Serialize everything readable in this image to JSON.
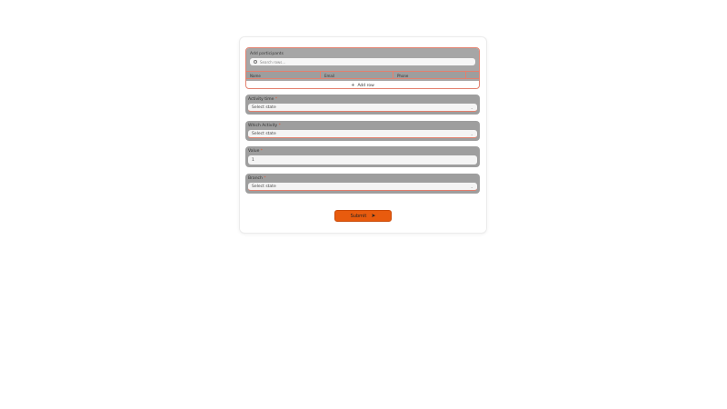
{
  "participants": {
    "label": "Add participants",
    "search_placeholder": "Search rows...",
    "columns": [
      "Name",
      "Email",
      "Phone"
    ],
    "add_row_label": "Add row"
  },
  "fields": {
    "activity_time": {
      "label": "Activity time",
      "value": "Select state"
    },
    "which_activity": {
      "label": "Which Activity",
      "value": "Select state"
    },
    "value": {
      "label": "Value",
      "value": "1"
    },
    "branch": {
      "label": "Branch",
      "value": "Select state"
    }
  },
  "required_marker": "*",
  "submit": {
    "label": "Submit",
    "icon": "send-icon"
  },
  "colors": {
    "accent": "#e85b0e",
    "error_border": "#e3806e",
    "field_bg": "#9e9e9e"
  }
}
